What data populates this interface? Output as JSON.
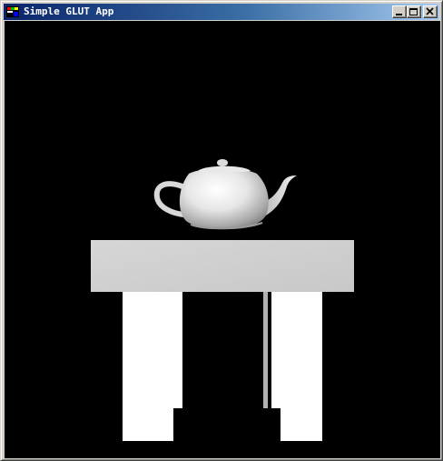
{
  "window": {
    "title": "Simple GLUT App",
    "icon": "glut-app-icon"
  },
  "caption_buttons": {
    "minimize": "minimize-icon",
    "maximize": "maximize-icon",
    "close": "close-icon"
  },
  "scene": {
    "background": "#000000",
    "objects": [
      "teapot",
      "table"
    ],
    "colors": {
      "tabletop": "#d0d0d0",
      "legs": "#ffffff",
      "teapot_light": "#ffffff",
      "teapot_shade": "#8a8a8a"
    }
  }
}
